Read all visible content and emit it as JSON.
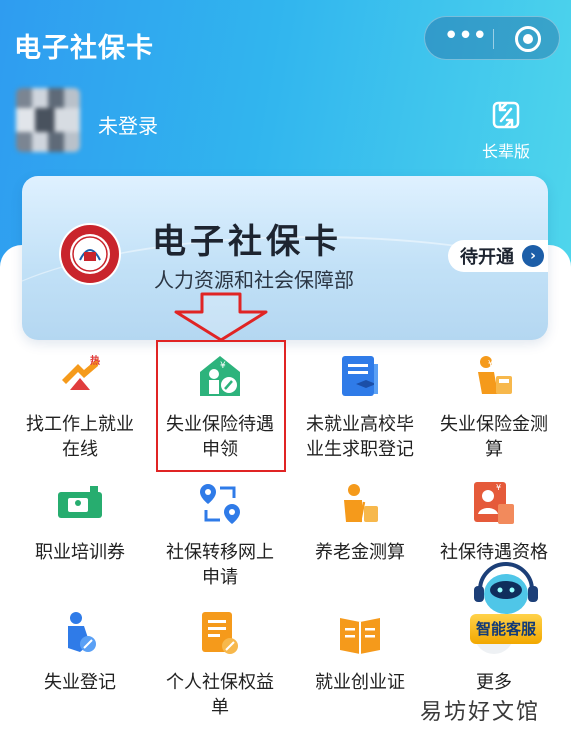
{
  "header": {
    "title": "电子社保卡",
    "more_icon": "more-dots-icon",
    "close_icon": "target-close-icon"
  },
  "user": {
    "login_label": "未登录",
    "elder_mode_label": "长辈版"
  },
  "card": {
    "title": "电子社保卡",
    "subtitle": "人力资源和社会保障部",
    "status_button": "待开通",
    "accent_color": "#1c5ea8"
  },
  "services": [
    {
      "label": "找工作上就业在线",
      "icon": "job-search-icon"
    },
    {
      "label": "失业保险待遇申领",
      "icon": "unemployment-benefit-icon"
    },
    {
      "label": "未就业高校毕业生求职登记",
      "icon": "graduate-register-icon"
    },
    {
      "label": "失业保险金测算",
      "icon": "unemployment-calc-icon"
    },
    {
      "label": "职业培训券",
      "icon": "training-voucher-icon"
    },
    {
      "label": "社保转移网上申请",
      "icon": "transfer-icon"
    },
    {
      "label": "养老金测算",
      "icon": "pension-calc-icon"
    },
    {
      "label": "社保待遇资格",
      "icon": "qualification-icon"
    },
    {
      "label": "失业登记",
      "icon": "unemployment-register-icon"
    },
    {
      "label": "个人社保权益单",
      "icon": "rights-statement-icon"
    },
    {
      "label": "就业创业证",
      "icon": "employment-cert-icon"
    },
    {
      "label": "更多",
      "icon": "more-icon"
    }
  ],
  "assistant": {
    "label": "智能客服"
  },
  "watermark": "易坊好文馆"
}
